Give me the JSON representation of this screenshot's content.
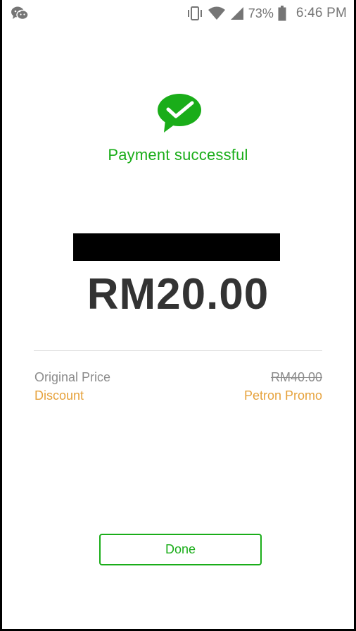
{
  "status_bar": {
    "battery_percent": "73%",
    "time": "6:46 PM",
    "icons": [
      "wechat-icon",
      "vibrate-icon",
      "wifi-icon",
      "signal-icon",
      "battery-icon"
    ]
  },
  "payment": {
    "title": "Payment successful",
    "amount": "RM20.00",
    "status_color": "#1aad19"
  },
  "details": {
    "original_price_label": "Original Price",
    "original_price_value": "RM40.00",
    "discount_label": "Discount",
    "discount_value": "Petron Promo",
    "discount_color": "#e6a23c"
  },
  "actions": {
    "done_label": "Done"
  }
}
